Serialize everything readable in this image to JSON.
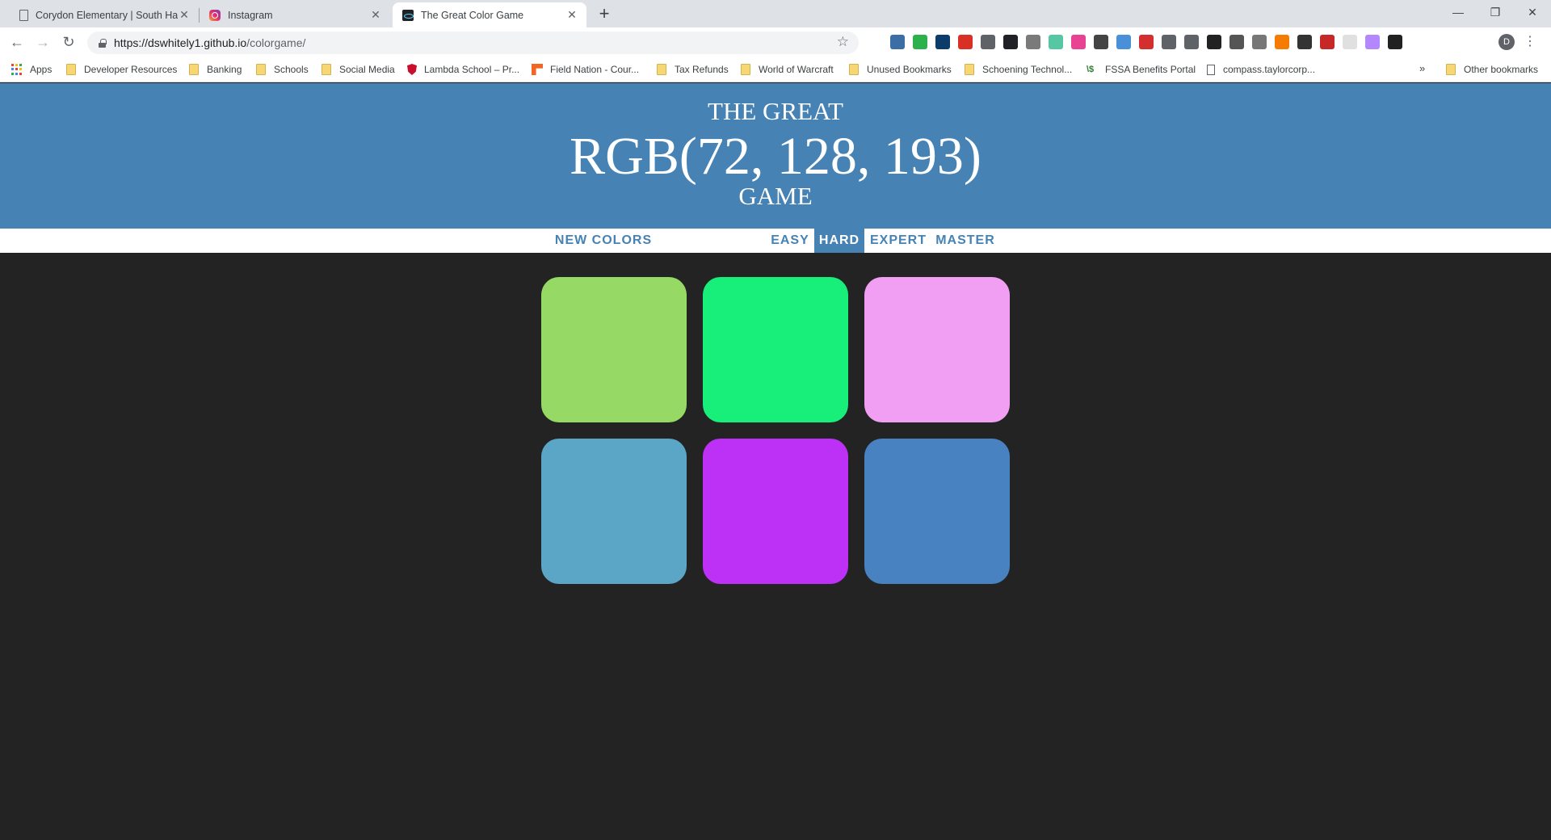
{
  "browser": {
    "tabs": [
      {
        "title": "Corydon Elementary | South Harr",
        "favicon": "document-icon",
        "active": false
      },
      {
        "title": "Instagram",
        "favicon": "instagram-icon",
        "active": false
      },
      {
        "title": "The Great Color Game",
        "favicon": "react-icon",
        "active": true
      }
    ],
    "url_host": "https://dswhitely1.github.io",
    "url_path": "/colorgame/",
    "profile_initial": "D",
    "bookmarks": [
      {
        "label": "Apps",
        "icon": "apps-icon"
      },
      {
        "label": "Developer Resources",
        "icon": "folder-icon"
      },
      {
        "label": "Banking",
        "icon": "folder-icon"
      },
      {
        "label": "Schools",
        "icon": "folder-icon"
      },
      {
        "label": "Social Media",
        "icon": "folder-icon"
      },
      {
        "label": "Lambda School – Pr...",
        "icon": "shield-icon"
      },
      {
        "label": "Field Nation - Cour...",
        "icon": "fieldnation-icon"
      },
      {
        "label": "Tax Refunds",
        "icon": "folder-icon"
      },
      {
        "label": "World of Warcraft",
        "icon": "folder-icon"
      },
      {
        "label": "Unused Bookmarks",
        "icon": "folder-icon"
      },
      {
        "label": "Schoening Technol...",
        "icon": "folder-icon"
      },
      {
        "label": "FSSA Benefits Portal",
        "icon": "fssa-icon"
      },
      {
        "label": "compass.taylorcorp...",
        "icon": "page-icon"
      }
    ],
    "bookmarks_overflow": "»",
    "other_bookmarks": "Other bookmarks",
    "extension_colors": [
      "#3a6ea5",
      "#2bb24c",
      "#0b3d6b",
      "#d93025",
      "#5f6368",
      "#202124",
      "#7a7a7a",
      "#57c7a3",
      "#e84393",
      "#444444",
      "#4a90d9",
      "#d32f2f",
      "#5f6368",
      "#5f6368",
      "#222222",
      "#555555",
      "#777777",
      "#f57c00",
      "#333333",
      "#c62828",
      "#e0e0e0",
      "#b388ff",
      "#212121"
    ]
  },
  "game": {
    "title_top": "THE GREAT",
    "target_rgb": "RGB(72, 128, 193)",
    "title_bottom": "GAME",
    "header_color": "#4682b4",
    "new_colors_label": "NEW COLORS",
    "modes": [
      "EASY",
      "HARD",
      "EXPERT",
      "MASTER"
    ],
    "selected_mode": "HARD",
    "squares": [
      "#96d964",
      "#17ef7a",
      "#f19ff3",
      "#5ba6c7",
      "#bd31f6",
      "#4882c1"
    ]
  }
}
